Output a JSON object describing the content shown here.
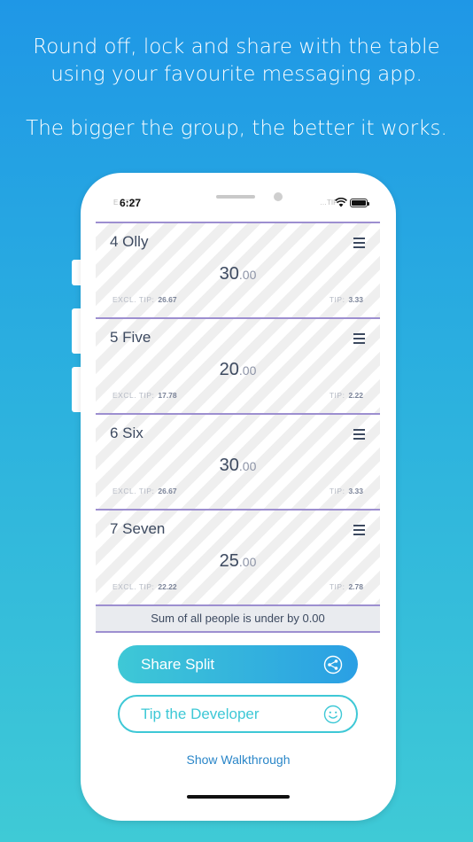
{
  "captions": {
    "line1": "Round off, lock and share with the table",
    "line2": "using your favourite messaging app.",
    "line3": "The bigger the group, the better it works."
  },
  "status": {
    "time": "6:27",
    "left_ghost": "E…TIP:",
    "right_ghost": "…TIP"
  },
  "people": [
    {
      "name": "4 Olly",
      "amount_main": "30",
      "amount_cents": ".00",
      "excl_label": "EXCL. TIP:",
      "excl_value": "26.67",
      "tip_label": "TIP:",
      "tip_value": "3.33"
    },
    {
      "name": "5 Five",
      "amount_main": "20",
      "amount_cents": ".00",
      "excl_label": "EXCL. TIP:",
      "excl_value": "17.78",
      "tip_label": "TIP:",
      "tip_value": "2.22"
    },
    {
      "name": "6 Six",
      "amount_main": "30",
      "amount_cents": ".00",
      "excl_label": "EXCL. TIP:",
      "excl_value": "26.67",
      "tip_label": "TIP:",
      "tip_value": "3.33"
    },
    {
      "name": "7 Seven",
      "amount_main": "25",
      "amount_cents": ".00",
      "excl_label": "EXCL. TIP:",
      "excl_value": "22.22",
      "tip_label": "TIP:",
      "tip_value": "2.78"
    }
  ],
  "sum_text": "Sum of all people is under by 0.00",
  "buttons": {
    "share_label": "Share Split",
    "share_icon": "share-icon",
    "tip_label": "Tip the Developer",
    "tip_icon": "smiley-icon",
    "walkthrough_label": "Show Walkthrough"
  },
  "colors": {
    "accent_teal": "#3ec8d6",
    "accent_blue": "#2a9fe4",
    "divider_purple": "#9d8fd0",
    "text_navy": "#3d4a60"
  }
}
